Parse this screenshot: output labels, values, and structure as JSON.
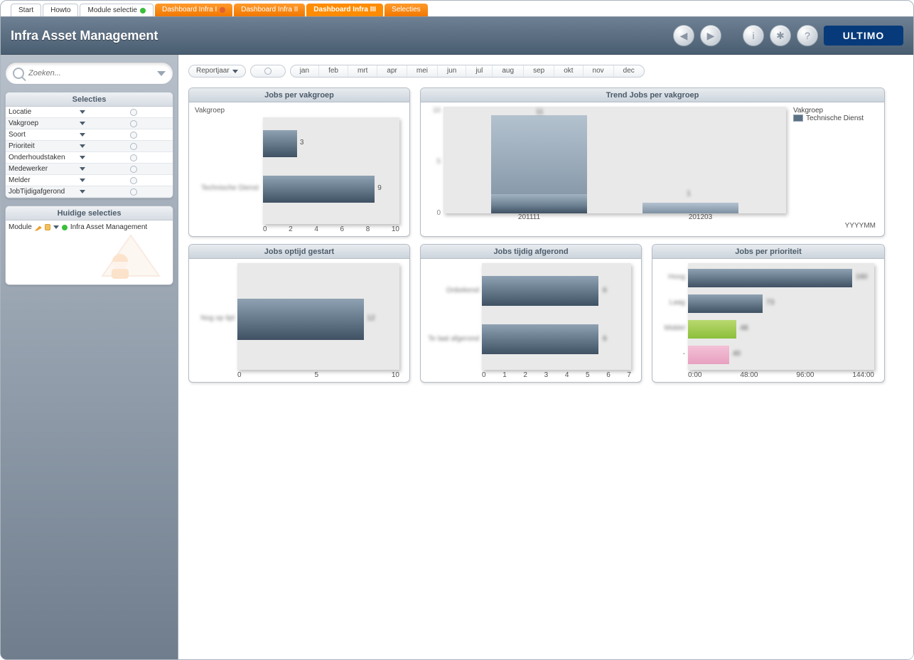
{
  "tabs": [
    {
      "label": "Start",
      "kind": "white"
    },
    {
      "label": "Howto",
      "kind": "white"
    },
    {
      "label": "Module selectie",
      "kind": "white",
      "dot": "green"
    },
    {
      "label": "Dashboard Infra I",
      "kind": "orange",
      "dot": "red"
    },
    {
      "label": "Dashboard Infra II",
      "kind": "orange"
    },
    {
      "label": "Dashboard Infra III",
      "kind": "orange",
      "active": true
    },
    {
      "label": "Selecties",
      "kind": "orange"
    }
  ],
  "header": {
    "title": "Infra Asset Management",
    "logo_text": "ULTIMO"
  },
  "search": {
    "placeholder": "Zoeken..."
  },
  "selecties_panel": {
    "title": "Selecties",
    "items": [
      "Locatie",
      "Vakgroep",
      "Soort",
      "Prioriteit",
      "Onderhoudstaken",
      "Medewerker",
      "Melder",
      "JobTijdigafgerond"
    ]
  },
  "huidige_panel": {
    "title": "Huidige selecties",
    "row_label": "Module",
    "row_value": "Infra Asset Management"
  },
  "filter_row": {
    "reportjaar_label": "Reportjaar",
    "months": [
      "jan",
      "feb",
      "mrt",
      "apr",
      "mei",
      "jun",
      "jul",
      "aug",
      "sep",
      "okt",
      "nov",
      "dec"
    ]
  },
  "charts": {
    "jobs_per_vakgroep": {
      "title": "Jobs per vakgroep",
      "ylabel": "Vakgroep",
      "categories_blur": [
        "",
        "Technische Dienst"
      ],
      "values": [
        3,
        9
      ],
      "xticks": [
        "0",
        "2",
        "4",
        "6",
        "8",
        "10"
      ]
    },
    "trend": {
      "title": "Trend Jobs per vakgroep",
      "legend_title": "Vakgroep",
      "legend_item": "Technische Dienst",
      "xaxis_label": "YYYYMM",
      "categories": [
        "201111",
        "201203"
      ],
      "series": [
        {
          "name": "light",
          "values": [
            11,
            1
          ]
        },
        {
          "name": "dark",
          "values": [
            2,
            1
          ]
        }
      ],
      "yticks": [
        "0",
        "5",
        "10"
      ]
    },
    "optijd_gestart": {
      "title": "Jobs optijd gestart",
      "categories_blur": [
        "Nog op tijd"
      ],
      "values": [
        12
      ],
      "xticks": [
        "0",
        "5",
        "10"
      ]
    },
    "tijdig_afgerond": {
      "title": "Jobs tijdig afgerond",
      "categories_blur": [
        "Onbekend",
        "Te laat afgerond"
      ],
      "values": [
        6,
        6
      ],
      "xticks": [
        "0",
        "1",
        "2",
        "3",
        "4",
        "5",
        "6",
        "7"
      ]
    },
    "per_prioriteit": {
      "title": "Jobs  per prioriteit",
      "categories_blur": [
        "Hoog",
        "Laag",
        "Middel",
        "-"
      ],
      "values": [
        160,
        73,
        48,
        40
      ],
      "colors": [
        "blue",
        "blue",
        "green",
        "pink"
      ],
      "xticks": [
        "0:00",
        "48:00",
        "96:00",
        "144:00"
      ]
    }
  },
  "chart_data": [
    {
      "type": "bar",
      "orientation": "horizontal",
      "title": "Jobs per vakgroep",
      "ylabel": "Vakgroep",
      "categories": [
        "(blurred)",
        "Technische Dienst"
      ],
      "values": [
        3,
        9
      ],
      "xlim": [
        0,
        10
      ]
    },
    {
      "type": "bar",
      "orientation": "vertical",
      "stacked": true,
      "title": "Trend Jobs per vakgroep",
      "x": [
        "201111",
        "201203"
      ],
      "series": [
        {
          "name": "Technische Dienst (upper)",
          "values": [
            11,
            1
          ]
        },
        {
          "name": "Technische Dienst (lower)",
          "values": [
            2,
            1
          ]
        }
      ],
      "xlabel": "YYYYMM",
      "ylim": [
        0,
        12
      ],
      "legend": [
        "Technische Dienst"
      ]
    },
    {
      "type": "bar",
      "orientation": "horizontal",
      "title": "Jobs optijd gestart",
      "categories": [
        "Nog op tijd"
      ],
      "values": [
        12
      ],
      "xlim": [
        0,
        12
      ]
    },
    {
      "type": "bar",
      "orientation": "horizontal",
      "title": "Jobs tijdig afgerond",
      "categories": [
        "Onbekend",
        "Te laat afgerond"
      ],
      "values": [
        6,
        6
      ],
      "xlim": [
        0,
        7
      ]
    },
    {
      "type": "bar",
      "orientation": "horizontal",
      "title": "Jobs per prioriteit",
      "categories": [
        "Hoog",
        "Laag",
        "Middel",
        "-"
      ],
      "values": [
        160,
        73,
        48,
        40
      ],
      "xlim": [
        0,
        168
      ],
      "xticks": [
        "0:00",
        "48:00",
        "96:00",
        "144:00"
      ]
    }
  ]
}
